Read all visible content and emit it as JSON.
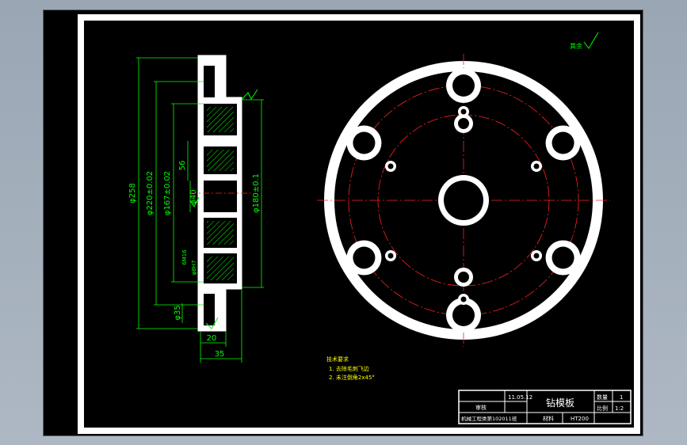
{
  "colors": {
    "background": "#000000",
    "frame": "#ffffff",
    "dimension": "#00ff00",
    "centerline": "#ff2020",
    "note_text": "#ffff00",
    "canvas_outer": "#a6b1be"
  },
  "dimensions": {
    "d258": "φ258",
    "d220": "φ220±0.02",
    "d167": "φ167±0.02",
    "d56": "56",
    "d40": "φ40",
    "d180": "φ180±0.1",
    "d35": "φ35",
    "m16": "6M16",
    "ref": "φ8H7",
    "w20": "20",
    "w35": "35"
  },
  "roughness": "其余",
  "notes": {
    "title": "技术要求",
    "item1": "1. 去除毛刺飞边",
    "item2": "2. 未注倒角2x45°"
  },
  "title_block": {
    "part_name": "钻模板",
    "designer_label": "审核",
    "scale_label": "比例",
    "scale_value": "1:2",
    "qty_label": "数量",
    "qty_value": "1",
    "material_label": "材料",
    "material_value": "HT200",
    "school": "机械工程类第102011班",
    "drawing_no": "11.05.12"
  }
}
